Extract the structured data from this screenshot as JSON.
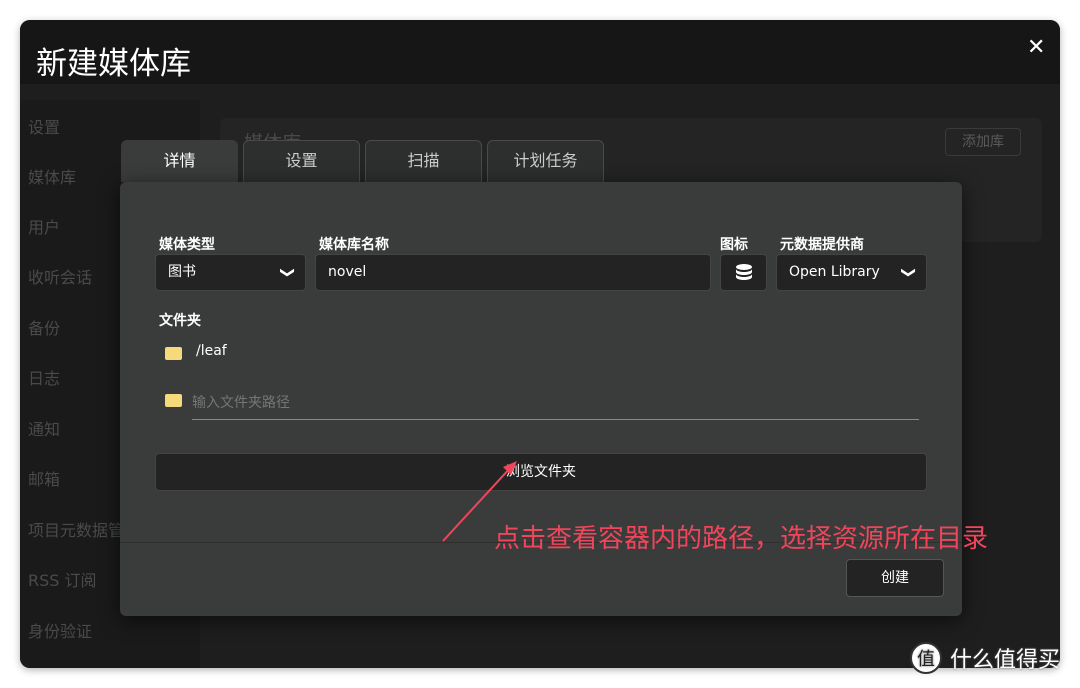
{
  "background": {
    "sidebar": [
      "设置",
      "媒体库",
      "用户",
      "收听会话",
      "备份",
      "日志",
      "通知",
      "邮箱",
      "项目元数据管",
      "RSS 订阅",
      "身份验证"
    ],
    "page_title": "媒体库",
    "add_button": "添加库"
  },
  "dialog": {
    "title": "新建媒体库",
    "close": "✕",
    "tabs": [
      "详情",
      "设置",
      "扫描",
      "计划任务"
    ],
    "media_type": {
      "label": "媒体类型",
      "value": "图书"
    },
    "library_name": {
      "label": "媒体库名称",
      "value": "novel"
    },
    "icon": {
      "label": "图标",
      "icon": "database-icon"
    },
    "metadata_provider": {
      "label": "元数据提供商",
      "value": "Open Library"
    },
    "folders": {
      "label": "文件夹",
      "items": [
        "/leaf"
      ],
      "placeholder": "输入文件夹路径"
    },
    "browse_button": "浏览文件夹",
    "create_button": "创建"
  },
  "annotation": "点击查看容器内的路径，选择资源所在目录",
  "watermark": {
    "logo": "值",
    "text": "什么值得买"
  },
  "colors": {
    "annotation": "#f0455a",
    "folder": "#f5d97a"
  }
}
